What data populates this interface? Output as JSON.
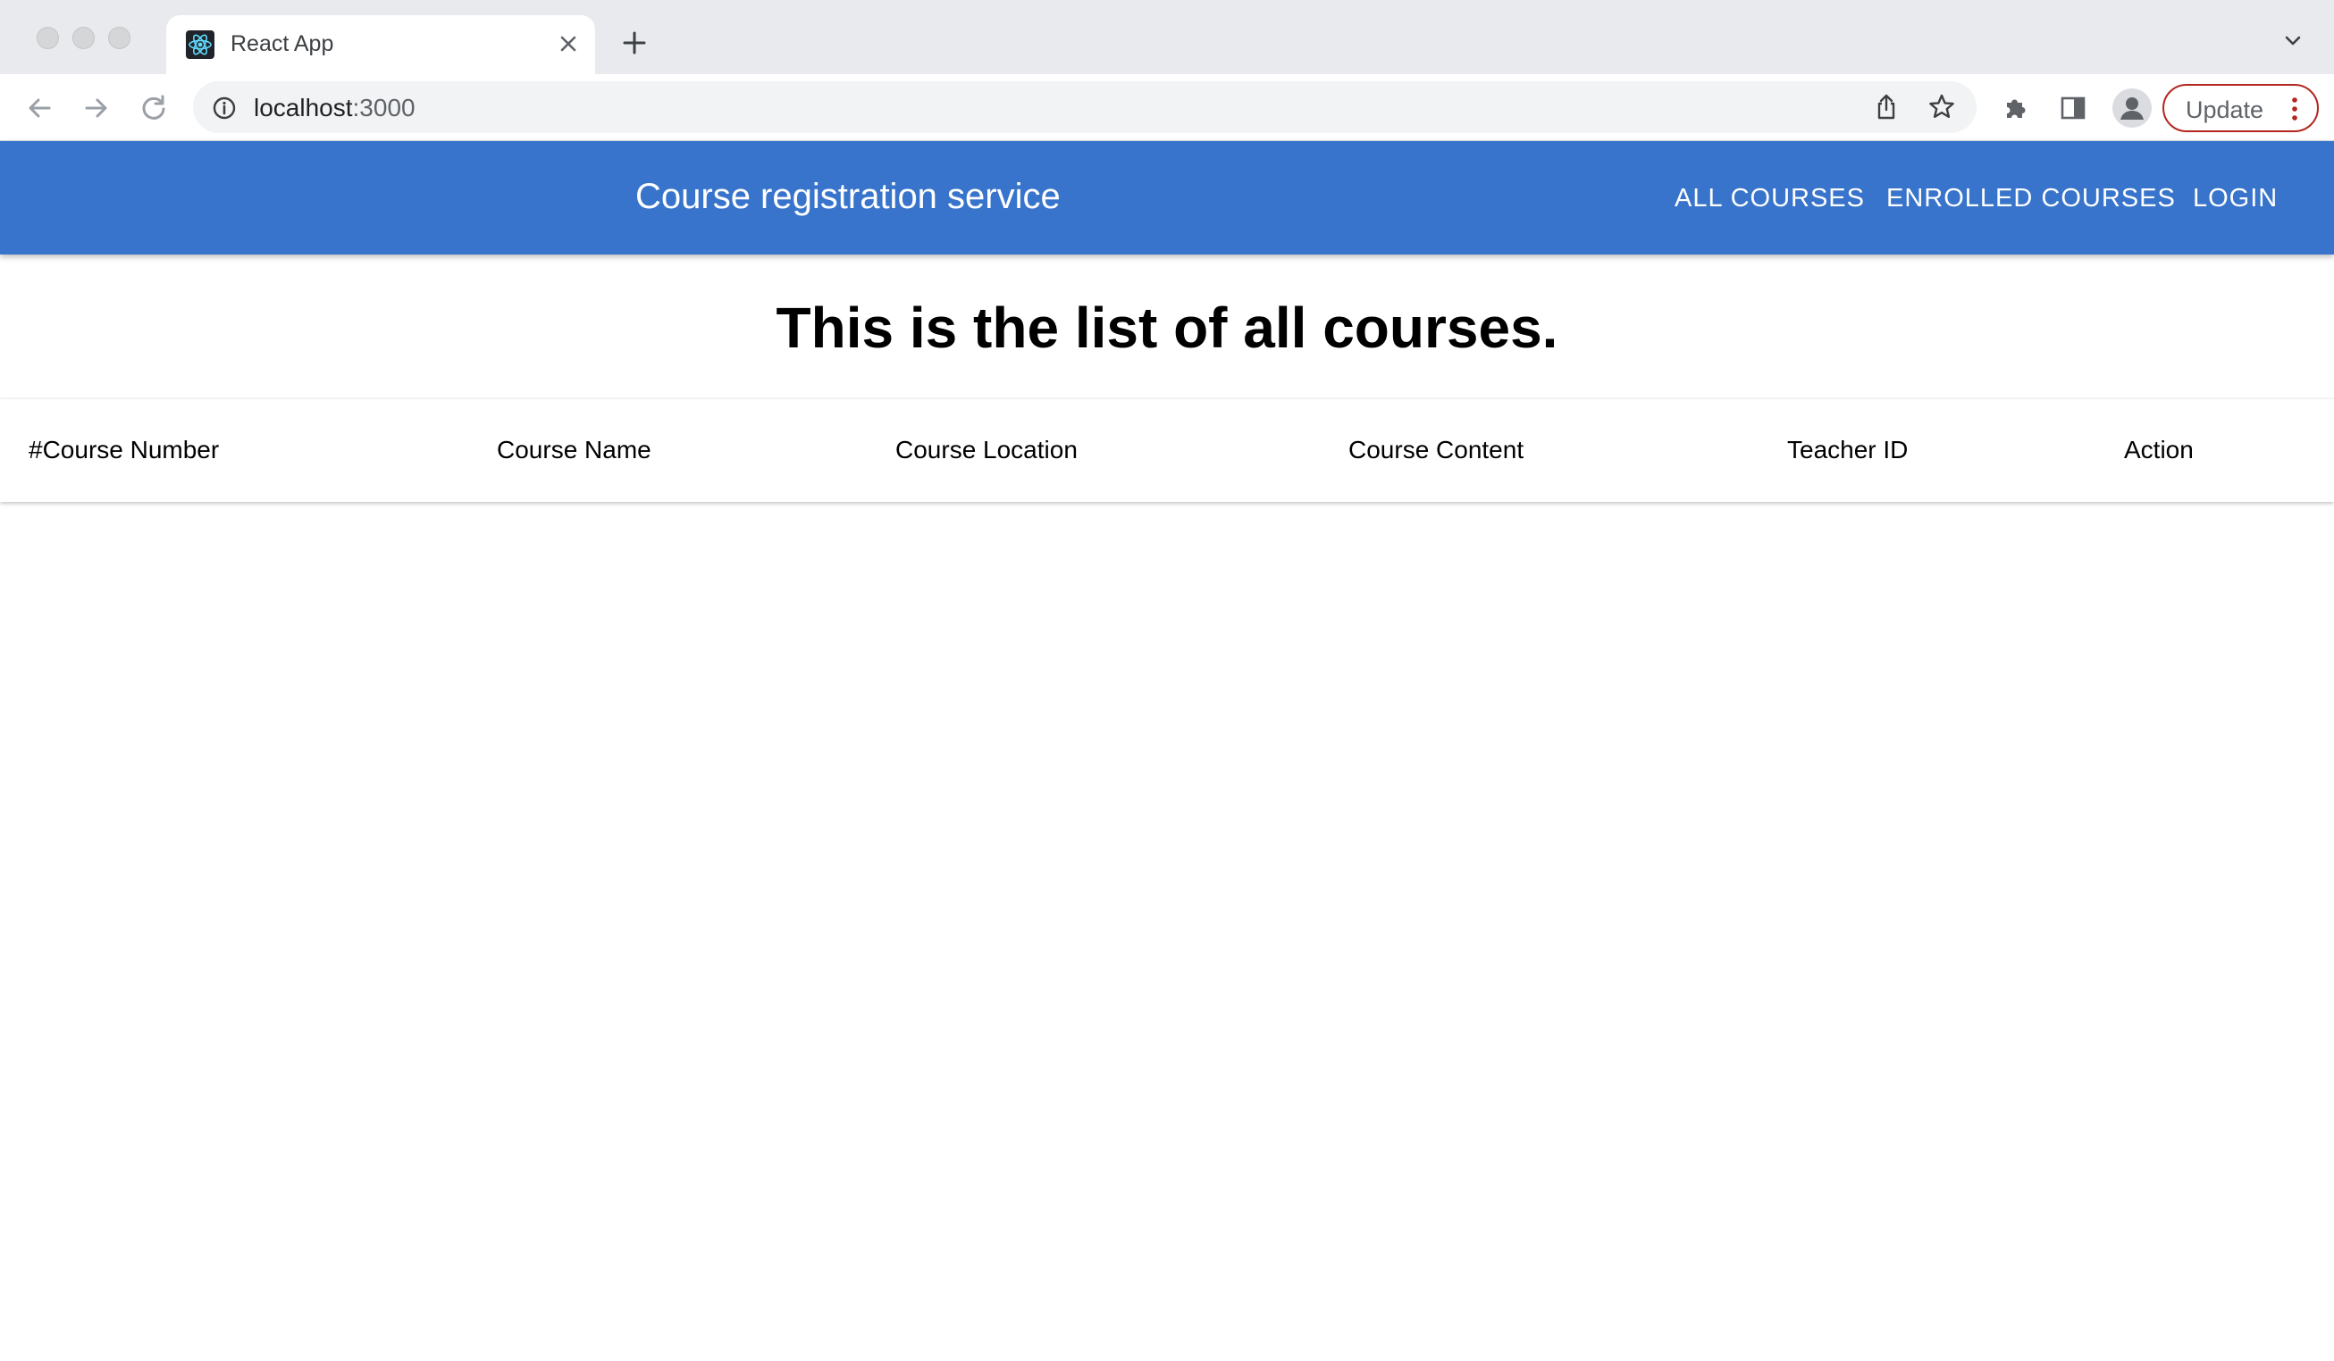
{
  "browser": {
    "tab_title": "React App",
    "url_host": "localhost",
    "url_port": ":3000",
    "update_label": "Update",
    "icons": {
      "favicon": "react-logo-icon",
      "tab_close": "close-icon",
      "new_tab": "plus-icon",
      "tab_list": "chevron-down-icon",
      "back": "arrow-left-icon",
      "forward": "arrow-right-icon",
      "reload": "reload-icon",
      "site_info": "info-icon",
      "share": "share-icon",
      "bookmark": "star-icon",
      "extensions": "puzzle-icon",
      "side_panel": "side-panel-icon",
      "profile": "avatar",
      "menu": "kebab-menu-icon"
    }
  },
  "header": {
    "title": "Course registration service",
    "nav": {
      "all_courses": "ALL COURSES",
      "enrolled_courses": "ENROLLED COURSES",
      "login": "LOGIN"
    },
    "color": "#3874cb"
  },
  "main": {
    "heading": "This is the list of all courses.",
    "table": {
      "columns": [
        "#Course Number",
        "Course Name",
        "Course Location",
        "Course Content",
        "Teacher ID",
        "Action"
      ],
      "rows": []
    }
  }
}
